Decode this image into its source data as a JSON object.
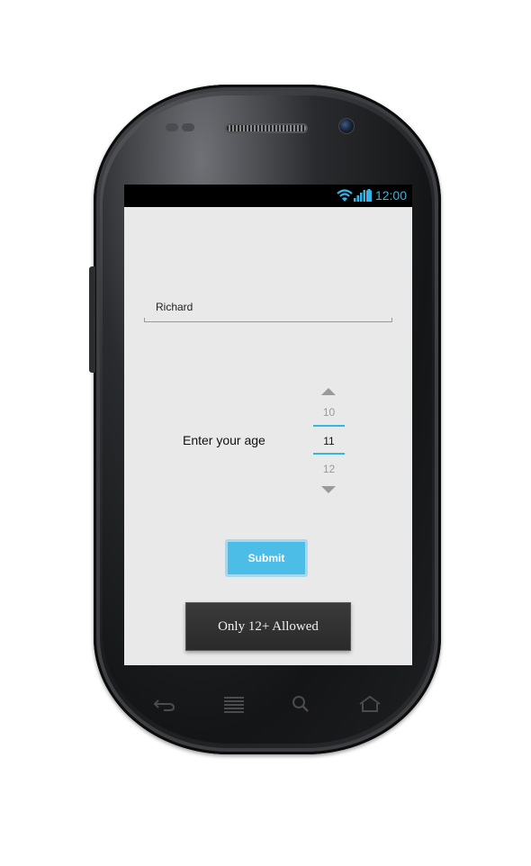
{
  "status_bar": {
    "time": "12:00",
    "icons": [
      "wifi-icon",
      "signal-icon",
      "battery-icon"
    ],
    "accent_color": "#33b5e5"
  },
  "form": {
    "name_value": "Richard",
    "age_label": "Enter your age",
    "age_picker": {
      "previous": "10",
      "current": "11",
      "next": "12"
    },
    "submit_label": "Submit",
    "submit_color": "#4cbde6"
  },
  "toast": {
    "message": "Only 12+ Allowed"
  },
  "hardware_keys": [
    "back-icon",
    "menu-icon",
    "search-icon",
    "home-icon"
  ]
}
